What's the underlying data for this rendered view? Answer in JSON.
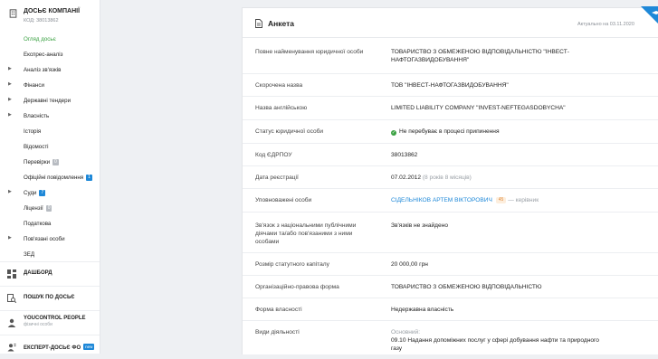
{
  "company": {
    "name": "ДОСЬЄ КОМПАНІЇ",
    "code": "КОД: 38013862"
  },
  "nav": [
    {
      "label": "Огляд досьє",
      "active": true
    },
    {
      "label": "Експрес-аналіз"
    },
    {
      "label": "Аналіз зв'язків",
      "caret": true
    },
    {
      "label": "Фінанси",
      "caret": true
    },
    {
      "label": "Державні тендери",
      "caret": true
    },
    {
      "label": "Власність",
      "caret": true
    },
    {
      "label": "Історія"
    },
    {
      "label": "Відомості"
    },
    {
      "label": "Перевірки",
      "badge": "0",
      "badge_color": "grey"
    },
    {
      "label": "Офіційні повідомлення",
      "badge": "1",
      "badge_color": "blue"
    },
    {
      "label": "Суди",
      "caret": true,
      "badge": "7",
      "badge_color": "blue"
    },
    {
      "label": "Ліцензії",
      "badge": "0",
      "badge_color": "grey"
    },
    {
      "label": "Податкова"
    },
    {
      "label": "Пов'язані особи",
      "caret": true
    },
    {
      "label": "ЗЕД"
    }
  ],
  "bottom": {
    "dashboard": "ДАШБОРД",
    "search": "ПОШУК ПО ДОСЬЄ",
    "people": "YOUCONTROL PEOPLE",
    "people_sub": "фізичні особи",
    "expert": "ЕКСПЕРТ-ДОСЬЄ ФО",
    "expert_badge": "new"
  },
  "card": {
    "title": "Анкета",
    "updated": "Актуально на 03.11.2020"
  },
  "rows": {
    "full_name": {
      "key": "Повне найменування юридичної особи",
      "value": "ТОВАРИСТВО З ОБМЕЖЕНОЮ ВІДПОВІДАЛЬНІСТЮ \"ІНВЕСТ-НАФТОГАЗВИДОБУВАННЯ\""
    },
    "short_name": {
      "key": "Скорочена назва",
      "value": "ТОВ \"ІНВЕСТ-НАФТОГАЗВИДОБУВАННЯ\""
    },
    "english_name": {
      "key": "Назва англійською",
      "value": "LIMITED LIABILITY COMPANY \"INVEST-NEFTEGASDOBYCHA\""
    },
    "status": {
      "key": "Статус юридичної особи",
      "value": "Не перебуває в процесі припинення"
    },
    "edrpou": {
      "key": "Код ЄДРПОУ",
      "value": "38013862"
    },
    "reg_date": {
      "key": "Дата реєстрації",
      "value": "07.02.2012",
      "extra": "(8 років 8 місяців)"
    },
    "authorized": {
      "key": "Уповноважені особи",
      "value": "СІДЕЛЬНІКОВ АРТЕМ ВІКТОРОВИЧ",
      "badge": "45",
      "role": "— керівник"
    },
    "pep": {
      "key": "Зв'язок з національними публічними діячами та/або пов'язаними з ними особами",
      "value": "Зв'язків не знайдено"
    },
    "capital": {
      "key": "Розмір статутного капіталу",
      "value": "20 000,00 грн"
    },
    "legal_form": {
      "key": "Організаційно-правова форма",
      "value": "ТОВАРИСТВО З ОБМЕЖЕНОЮ ВІДПОВІДАЛЬНІСТЮ"
    },
    "ownership": {
      "key": "Форма власності",
      "value": "Недержавна власність"
    },
    "activities": {
      "key": "Види діяльності",
      "label": "Основний:",
      "value": "09.10 Надання допоміжних послуг у сфері добування нафти та природного газу"
    }
  },
  "colors": {
    "accent_green": "#3aa142",
    "link_blue": "#1e88d8",
    "badge_orange": "#e0893a"
  }
}
